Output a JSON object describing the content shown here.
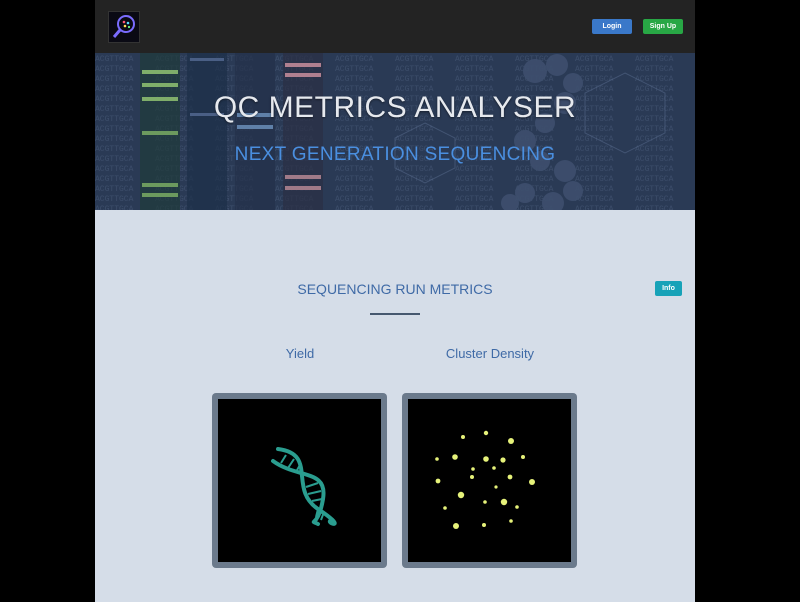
{
  "navbar": {
    "logo_icon": "magnifier-logo-icon",
    "login_label": "Login",
    "signup_label": "Sign Up"
  },
  "hero": {
    "title": "QC METRICS ANALYSER",
    "subtitle": "NEXT GENERATION SEQUENCING"
  },
  "section": {
    "title": "SEQUENCING RUN METRICS",
    "info_label": "Info"
  },
  "metrics": {
    "yield_label": "Yield",
    "yield_icon": "dna-helix-icon",
    "density_label": "Cluster Density",
    "density_icon": "cluster-dots-icon"
  },
  "colors": {
    "navbar_bg": "#232323",
    "login": "#3a78c9",
    "signup": "#28a745",
    "info": "#17a2b8",
    "accent_text": "#3f6aa6",
    "hero_subtitle": "#4a8fe0",
    "page_bg": "#d5dde8",
    "dna": "#2a9d8f",
    "cluster": "#e6f27a"
  }
}
